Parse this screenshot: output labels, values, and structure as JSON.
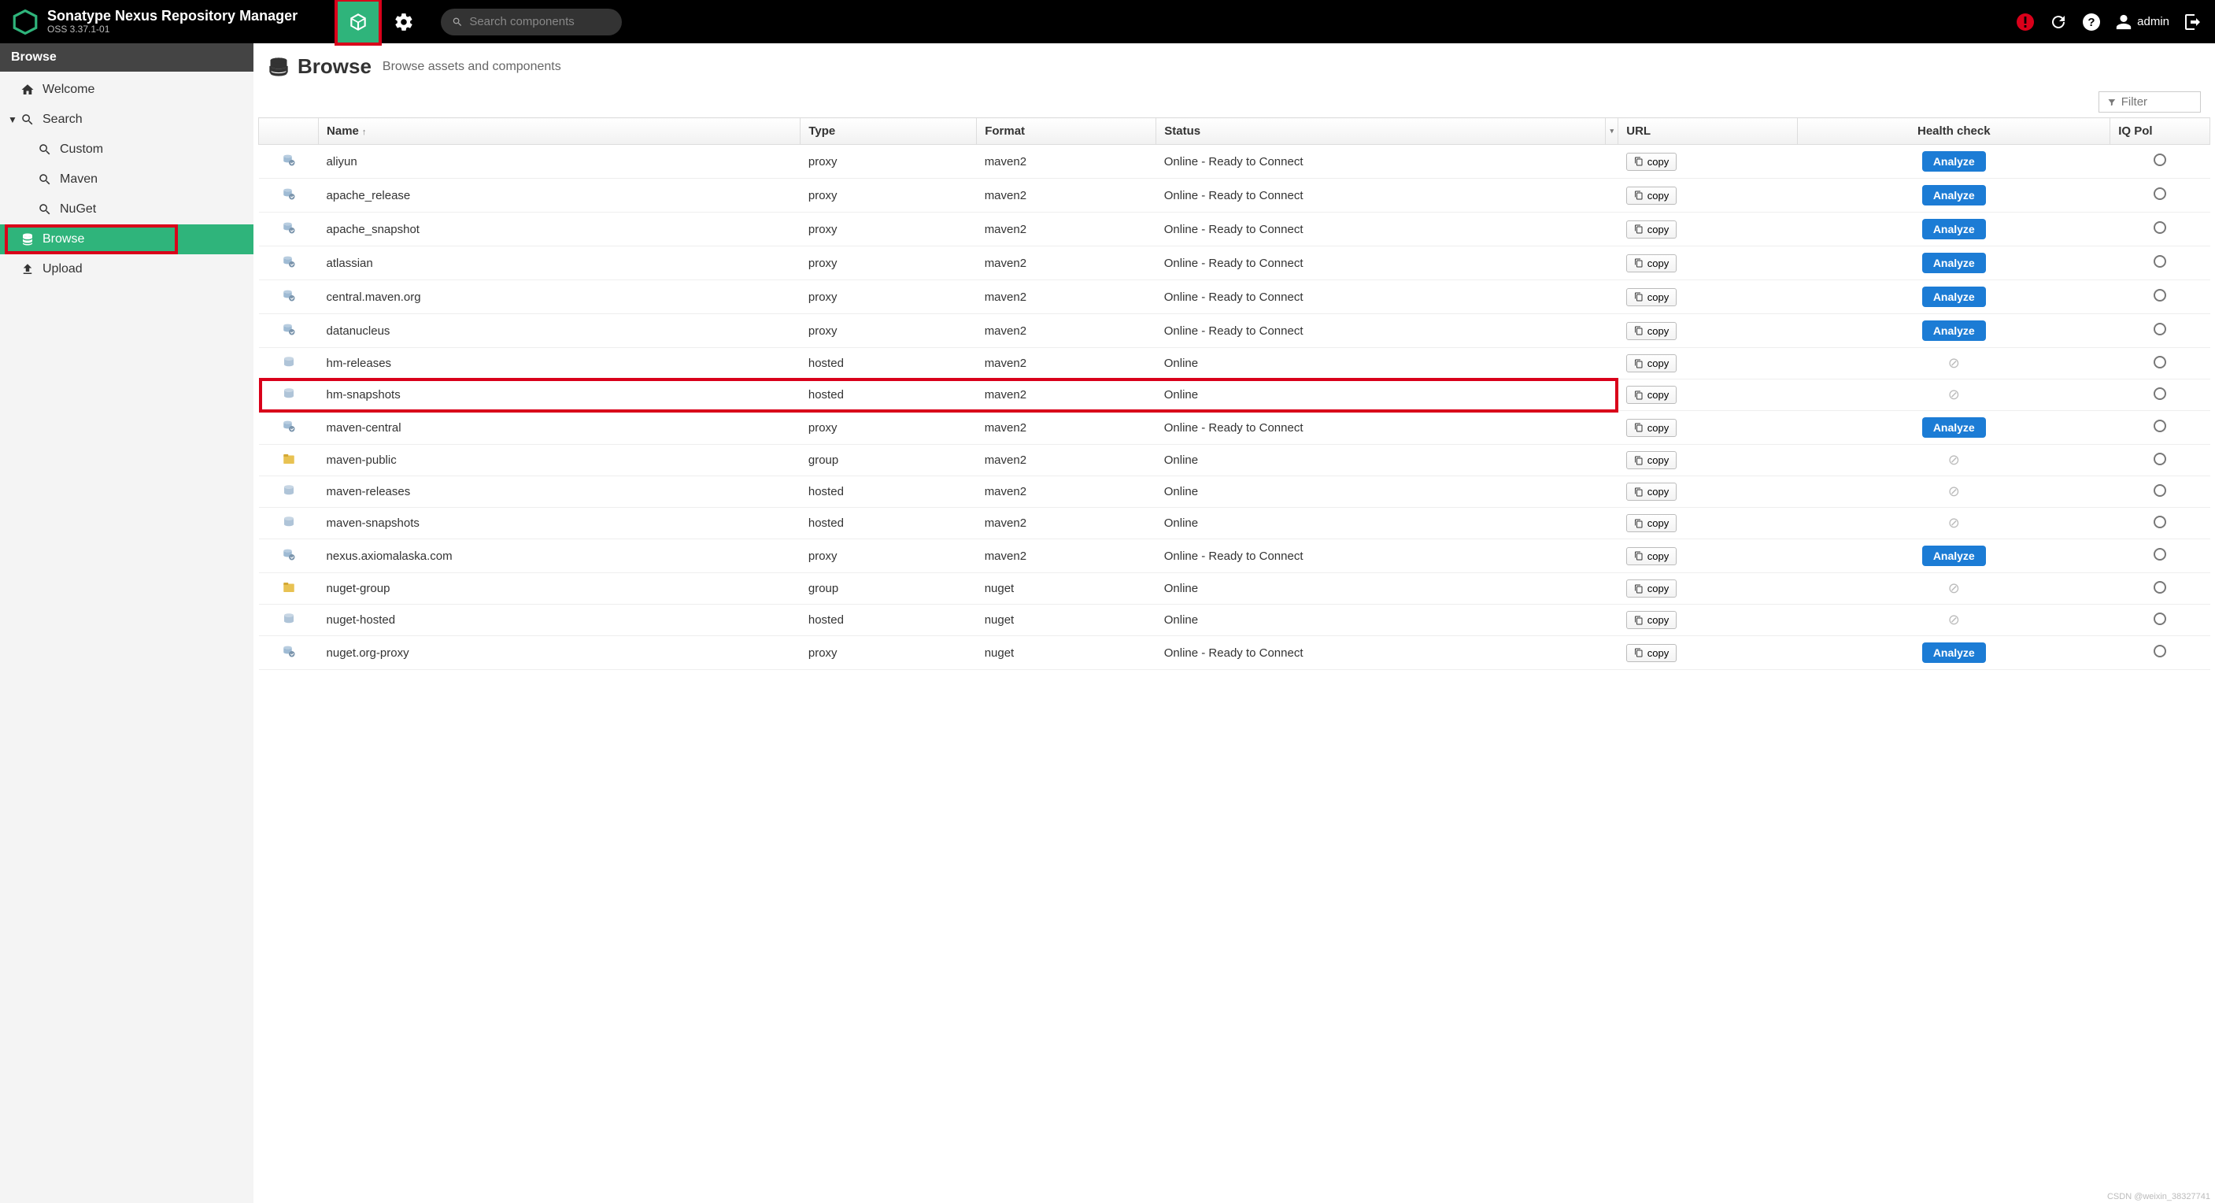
{
  "header": {
    "product": "Sonatype Nexus Repository Manager",
    "version": "OSS 3.37.1-01",
    "search_placeholder": "Search components",
    "user": "admin"
  },
  "sidebar": {
    "header": "Browse",
    "items": [
      {
        "label": "Welcome",
        "icon": "home",
        "level": 0
      },
      {
        "label": "Search",
        "icon": "search",
        "level": 0,
        "expandable": true
      },
      {
        "label": "Custom",
        "icon": "search",
        "level": 1
      },
      {
        "label": "Maven",
        "icon": "search",
        "level": 1
      },
      {
        "label": "NuGet",
        "icon": "search",
        "level": 1
      },
      {
        "label": "Browse",
        "icon": "database",
        "level": 0,
        "active": true,
        "highlight": true
      },
      {
        "label": "Upload",
        "icon": "upload",
        "level": 0
      }
    ]
  },
  "page": {
    "title": "Browse",
    "subtitle": "Browse assets and components",
    "filter_placeholder": "Filter"
  },
  "columns": {
    "name": "Name",
    "type": "Type",
    "format": "Format",
    "status": "Status",
    "url": "URL",
    "health": "Health check",
    "iq": "IQ Pol"
  },
  "buttons": {
    "copy": "copy",
    "analyze": "Analyze"
  },
  "rows": [
    {
      "name": "aliyun",
      "type": "proxy",
      "format": "maven2",
      "status": "Online - Ready to Connect",
      "icon": "proxy",
      "health": "analyze"
    },
    {
      "name": "apache_release",
      "type": "proxy",
      "format": "maven2",
      "status": "Online - Ready to Connect",
      "icon": "proxy",
      "health": "analyze"
    },
    {
      "name": "apache_snapshot",
      "type": "proxy",
      "format": "maven2",
      "status": "Online - Ready to Connect",
      "icon": "proxy",
      "health": "analyze"
    },
    {
      "name": "atlassian",
      "type": "proxy",
      "format": "maven2",
      "status": "Online - Ready to Connect",
      "icon": "proxy",
      "health": "analyze"
    },
    {
      "name": "central.maven.org",
      "type": "proxy",
      "format": "maven2",
      "status": "Online - Ready to Connect",
      "icon": "proxy",
      "health": "analyze"
    },
    {
      "name": "datanucleus",
      "type": "proxy",
      "format": "maven2",
      "status": "Online - Ready to Connect",
      "icon": "proxy",
      "health": "analyze"
    },
    {
      "name": "hm-releases",
      "type": "hosted",
      "format": "maven2",
      "status": "Online",
      "icon": "hosted",
      "health": "disabled"
    },
    {
      "name": "hm-snapshots",
      "type": "hosted",
      "format": "maven2",
      "status": "Online",
      "icon": "hosted",
      "health": "disabled",
      "highlight": true
    },
    {
      "name": "maven-central",
      "type": "proxy",
      "format": "maven2",
      "status": "Online - Ready to Connect",
      "icon": "proxy",
      "health": "analyze"
    },
    {
      "name": "maven-public",
      "type": "group",
      "format": "maven2",
      "status": "Online",
      "icon": "group",
      "health": "disabled"
    },
    {
      "name": "maven-releases",
      "type": "hosted",
      "format": "maven2",
      "status": "Online",
      "icon": "hosted",
      "health": "disabled"
    },
    {
      "name": "maven-snapshots",
      "type": "hosted",
      "format": "maven2",
      "status": "Online",
      "icon": "hosted",
      "health": "disabled"
    },
    {
      "name": "nexus.axiomalaska.com",
      "type": "proxy",
      "format": "maven2",
      "status": "Online - Ready to Connect",
      "icon": "proxy",
      "health": "analyze"
    },
    {
      "name": "nuget-group",
      "type": "group",
      "format": "nuget",
      "status": "Online",
      "icon": "group",
      "health": "disabled"
    },
    {
      "name": "nuget-hosted",
      "type": "hosted",
      "format": "nuget",
      "status": "Online",
      "icon": "hosted",
      "health": "disabled"
    },
    {
      "name": "nuget.org-proxy",
      "type": "proxy",
      "format": "nuget",
      "status": "Online - Ready to Connect",
      "icon": "proxy",
      "health": "analyze"
    }
  ],
  "watermark": "CSDN @weixin_38327741"
}
